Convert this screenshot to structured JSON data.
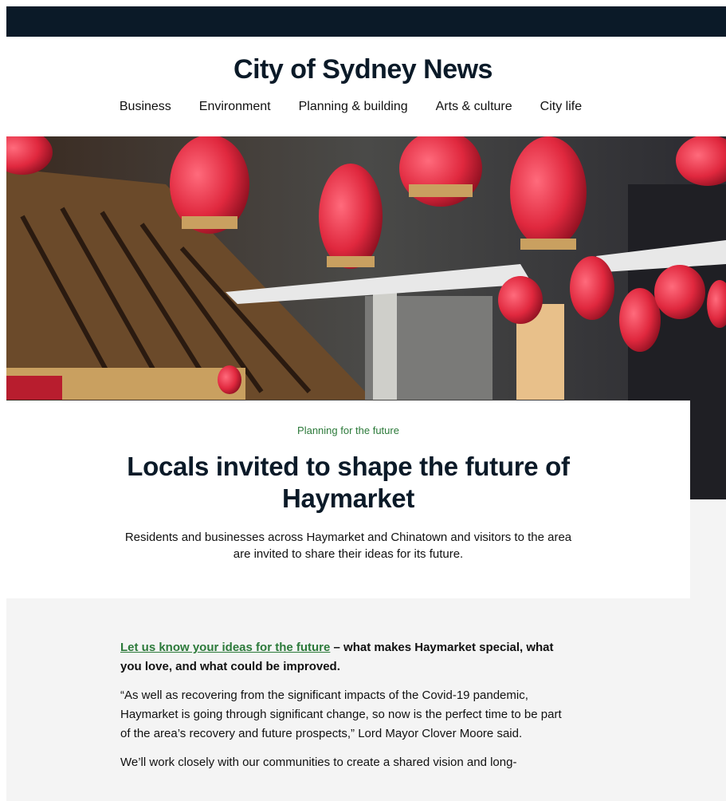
{
  "site": {
    "title": "City of Sydney News"
  },
  "nav": [
    {
      "label": "Business"
    },
    {
      "label": "Environment"
    },
    {
      "label": "Planning & building"
    },
    {
      "label": "Arts & culture"
    },
    {
      "label": "City life"
    }
  ],
  "article": {
    "kicker": "Planning for the future",
    "headline": "Locals invited to shape the future of Haymarket",
    "standfirst": "Residents and businesses across Haymarket and Chinatown and visitors to the area are invited to share their ideas for its future.",
    "lead_link": "Let us know your ideas for the future",
    "lead_rest": " – what makes Haymarket special, what you love, and what could be improved.",
    "quote": "“As well as recovering from the significant impacts of the Covid-19 pandemic, Haymarket is going through significant change, so now is the perfect time to be part of the area’s recovery and future prospects,” Lord Mayor Clover Moore said.",
    "para3": "We’ll work closely with our communities to create a shared vision and long-"
  },
  "colors": {
    "topbar": "#0b1a28",
    "accent_green": "#2c7a3a",
    "lantern_red": "#e0283e"
  }
}
